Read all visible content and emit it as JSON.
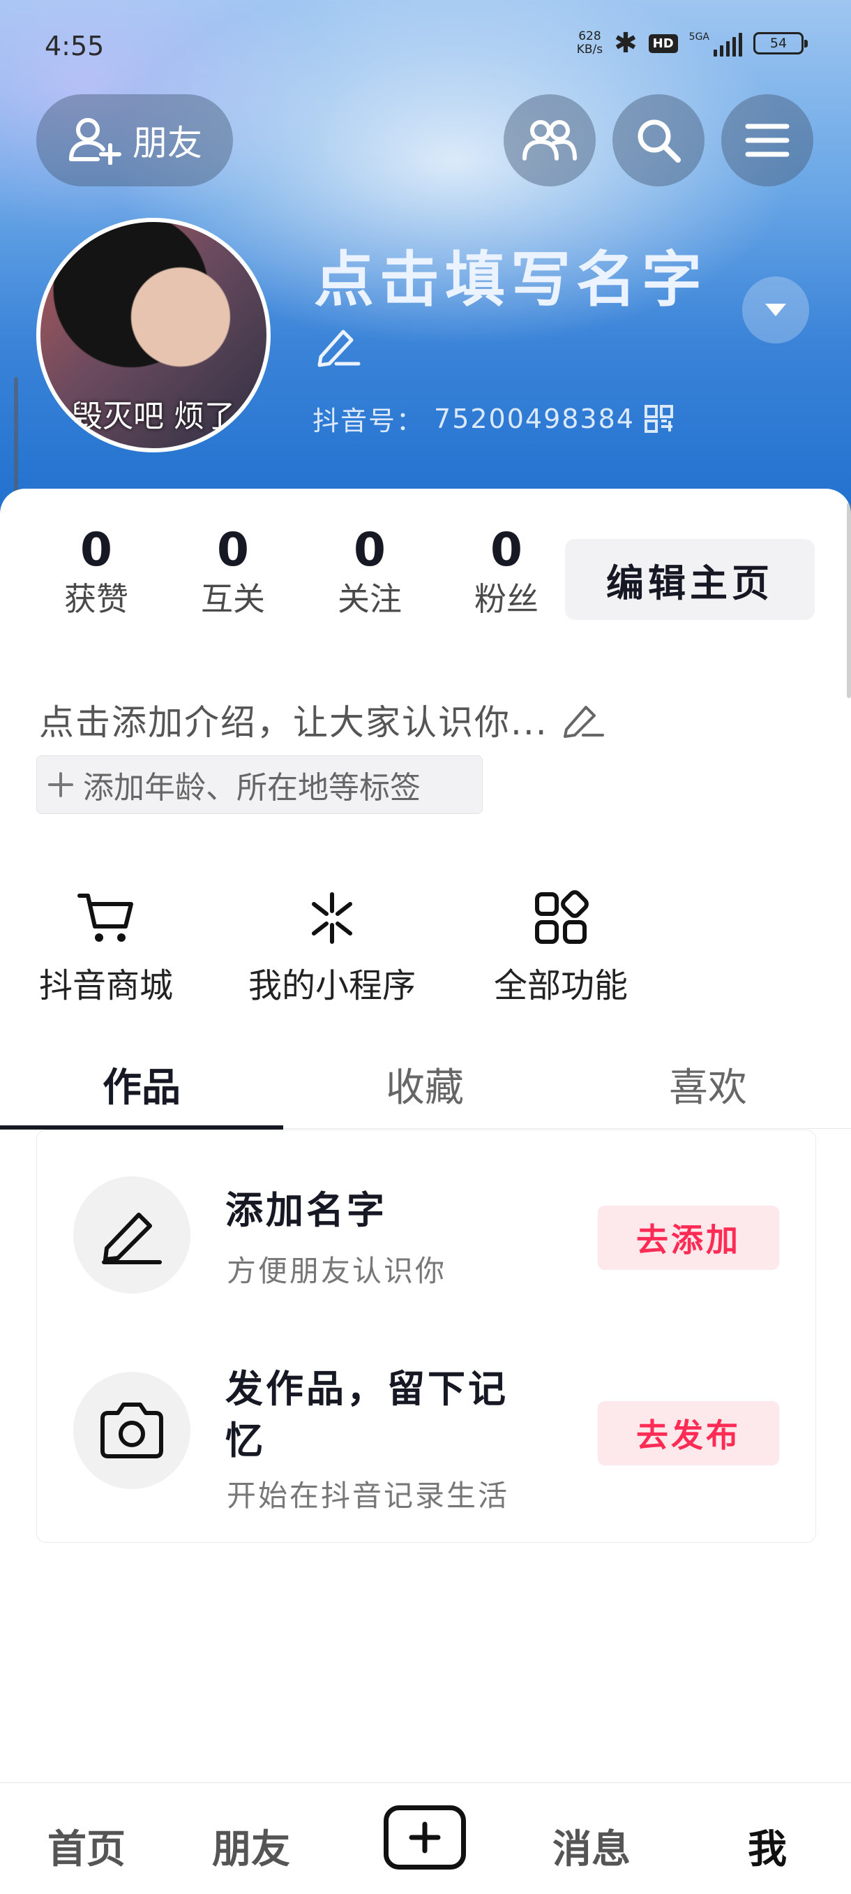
{
  "status_bar": {
    "time": "4:55",
    "net_speed_value": "628",
    "net_speed_unit": "KB/s",
    "hd": "HD",
    "network": "5GA",
    "battery": "54"
  },
  "top": {
    "friend_label": "朋友"
  },
  "profile": {
    "avatar_caption": "毁灭吧 烦了",
    "name": "点击填写名字",
    "uid_label": "抖音号：",
    "uid_value": "75200498384"
  },
  "stats": [
    {
      "value": "0",
      "label": "获赞"
    },
    {
      "value": "0",
      "label": "互关"
    },
    {
      "value": "0",
      "label": "关注"
    },
    {
      "value": "0",
      "label": "粉丝"
    }
  ],
  "edit_home_label": "编辑主页",
  "bio_placeholder": "点击添加介绍，让大家认识你...",
  "tag_button_label": "添加年龄、所在地等标签",
  "shortcuts": [
    {
      "label": "抖音商城",
      "icon": "cart-icon"
    },
    {
      "label": "我的小程序",
      "icon": "mini-program-icon"
    },
    {
      "label": "全部功能",
      "icon": "all-functions-icon"
    }
  ],
  "tabs": [
    "作品",
    "收藏",
    "喜欢"
  ],
  "tasks": [
    {
      "title": "添加名字",
      "subtitle": "方便朋友认识你",
      "button": "去添加",
      "icon": "pencil-icon"
    },
    {
      "title": "发作品，留下记忆",
      "subtitle": "开始在抖音记录生活",
      "button": "去发布",
      "icon": "camera-icon"
    }
  ],
  "bottom_nav": {
    "home": "首页",
    "friends": "朋友",
    "messages": "消息",
    "me": "我"
  },
  "colors": {
    "accent": "#fe2c55",
    "header_blue": "#1f6fce"
  }
}
